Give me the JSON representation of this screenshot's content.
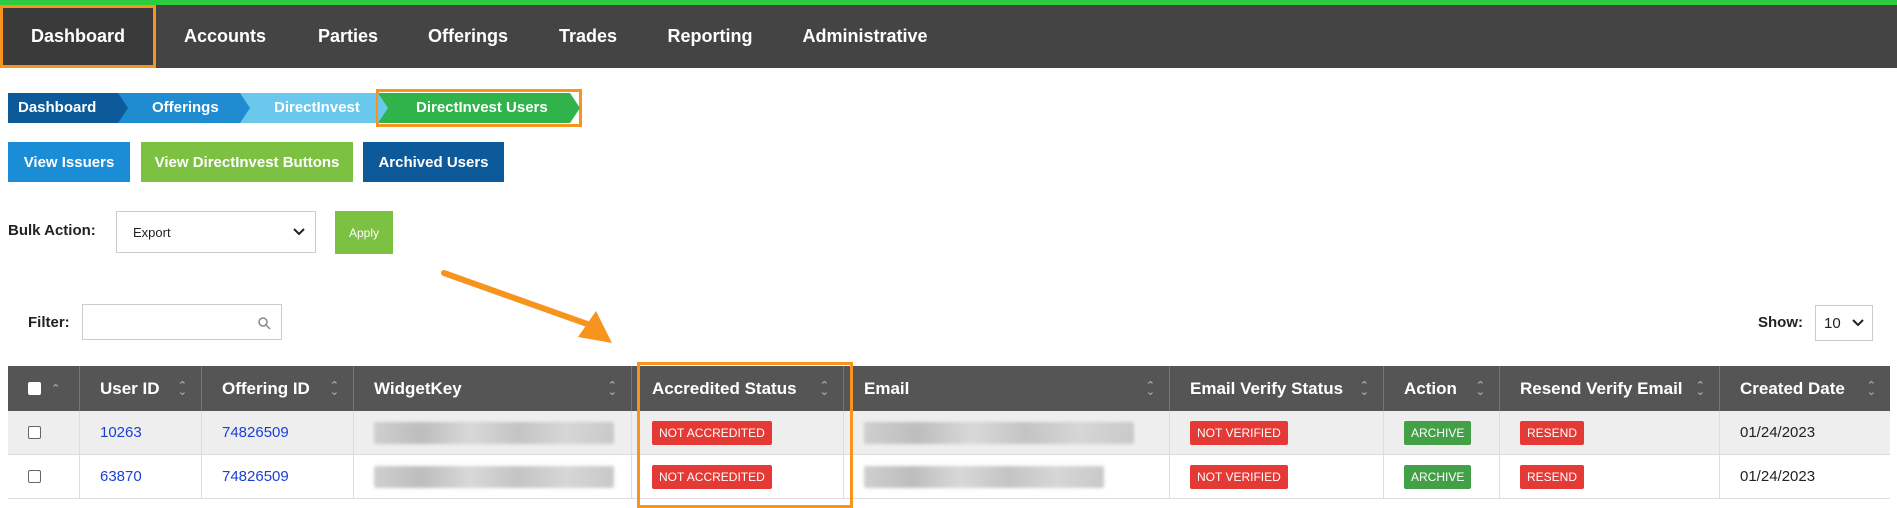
{
  "nav": {
    "items": [
      {
        "label": "Dashboard",
        "active": true
      },
      {
        "label": "Accounts"
      },
      {
        "label": "Parties"
      },
      {
        "label": "Offerings"
      },
      {
        "label": "Trades"
      },
      {
        "label": "Reporting"
      },
      {
        "label": "Administrative"
      }
    ]
  },
  "breadcrumbs": [
    "Dashboard",
    "Offerings",
    "DirectInvest",
    "DirectInvest Users"
  ],
  "actions": {
    "view_issuers": "View Issuers",
    "view_buttons": "View DirectInvest Buttons",
    "archived_users": "Archived Users"
  },
  "bulk": {
    "label": "Bulk Action:",
    "selected": "Export",
    "apply": "Apply"
  },
  "filter": {
    "label": "Filter:",
    "value": ""
  },
  "show": {
    "label": "Show:",
    "value": "10"
  },
  "table": {
    "headers": [
      "User ID",
      "Offering ID",
      "WidgetKey",
      "Accredited Status",
      "Email",
      "Email Verify Status",
      "Action",
      "Resend Verify Email",
      "Created Date"
    ],
    "rows": [
      {
        "user_id": "10263",
        "offering_id": "74826509",
        "accredited": "NOT ACCREDITED",
        "email_verify": "NOT VERIFIED",
        "action": "ARCHIVE",
        "resend": "RESEND",
        "created": "01/24/2023"
      },
      {
        "user_id": "63870",
        "offering_id": "74826509",
        "accredited": "NOT ACCREDITED",
        "email_verify": "NOT VERIFIED",
        "action": "ARCHIVE",
        "resend": "RESEND",
        "created": "01/24/2023"
      }
    ]
  },
  "colors": {
    "nav_bg": "#444444",
    "accent_green": "#2ecc40",
    "highlight_orange": "#f7941d",
    "badge_red": "#e53935",
    "badge_green": "#43a047"
  }
}
